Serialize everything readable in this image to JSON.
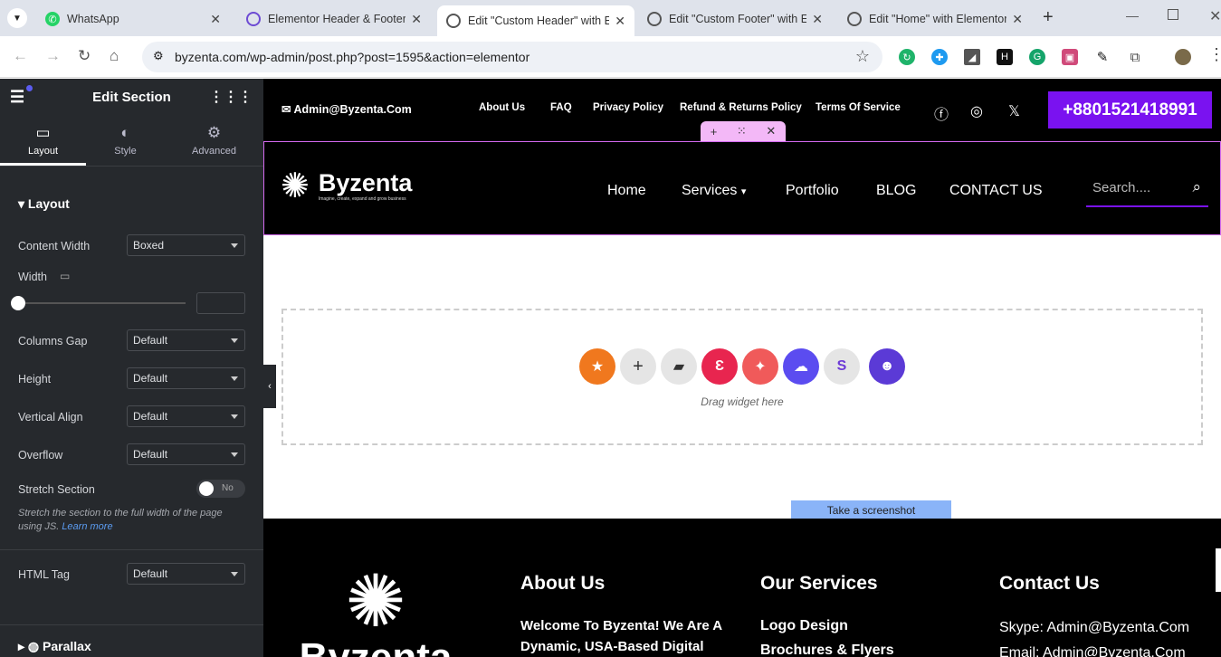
{
  "browser": {
    "tabs": [
      {
        "title": "WhatsApp",
        "icon": "whatsapp-icon",
        "color": "#25d366"
      },
      {
        "title": "Elementor Header & Footer",
        "icon": "elementor-hf-icon",
        "color": "#6d4bd3"
      },
      {
        "title": "Edit \"Custom Header\" with E",
        "icon": "globe-icon",
        "color": "#555"
      },
      {
        "title": "Edit \"Custom Footer\" with El",
        "icon": "globe-icon",
        "color": "#555"
      },
      {
        "title": "Edit \"Home\" with Elementor",
        "icon": "globe-icon",
        "color": "#555"
      }
    ],
    "url": "byzenta.com/wp-admin/post.php?post=1595&action=elementor"
  },
  "panel": {
    "title": "Edit Section",
    "tabs": [
      {
        "label": "Layout"
      },
      {
        "label": "Style"
      },
      {
        "label": "Advanced"
      }
    ],
    "section_heading": "Layout",
    "fields": {
      "content_width": {
        "label": "Content Width",
        "value": "Boxed"
      },
      "width": {
        "label": "Width"
      },
      "columns_gap": {
        "label": "Columns Gap",
        "value": "Default"
      },
      "height": {
        "label": "Height",
        "value": "Default"
      },
      "vertical_align": {
        "label": "Vertical Align",
        "value": "Default"
      },
      "overflow": {
        "label": "Overflow",
        "value": "Default"
      },
      "stretch": {
        "label": "Stretch Section",
        "toggle": "No",
        "help": "Stretch the section to the full width of the page using JS.",
        "link": "Learn more"
      },
      "html_tag": {
        "label": "HTML Tag",
        "value": "Default"
      }
    },
    "parallax": "Parallax"
  },
  "site": {
    "email": "Admin@Byzenta.Com",
    "top_links": [
      "About Us",
      "FAQ",
      "Privacy Policy",
      "Refund & Returns Policy",
      "Terms Of Service"
    ],
    "phone": "+8801521418991",
    "logo": "Byzenta",
    "tagline": "Imagine, create, expand and grow business",
    "nav": [
      "Home",
      "Services",
      "Portfolio",
      "BLOG",
      "CONTACT US"
    ],
    "search_placeholder": "Search....",
    "drag_text": "Drag widget here",
    "screenshot_btn": "Take a screenshot",
    "footer": {
      "about_title": "About Us",
      "about_text": "Welcome To Byzenta! We Are A",
      "about_text2": "Dynamic, USA-Based Digital",
      "services_title": "Our Services",
      "services": [
        "Logo Design",
        "Brochures & Flyers"
      ],
      "contact_title": "Contact Us",
      "skype": "Skype: Admin@Byzenta.Com",
      "email": "Email: Admin@Byzenta.Com",
      "logo": "Byzenta"
    }
  },
  "colors": {
    "accent": "#7a12f0",
    "panel": "#26292d",
    "link": "#5b9bf0"
  }
}
